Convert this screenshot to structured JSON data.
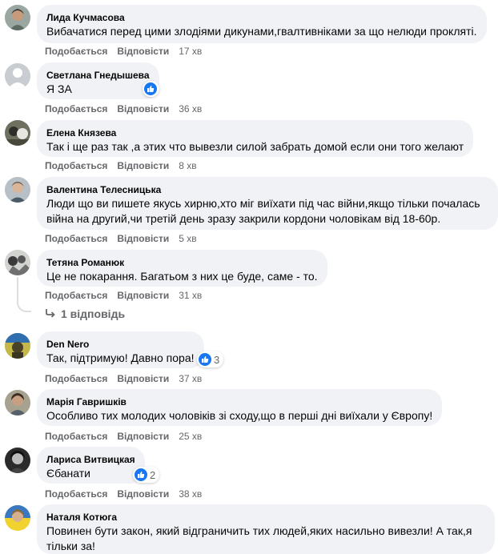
{
  "actions": {
    "like": "Подобається",
    "reply": "Відповісти"
  },
  "comments": [
    {
      "author": "Лида Кучмасова",
      "text": "Вибачатися перед цими злодіями дикунами,гвалтивніками за що нелюди прокляті.",
      "time": "17 хв"
    },
    {
      "author": "Светлана Гнедышева",
      "text": "Я ЗА",
      "time": "36 хв"
    },
    {
      "author": "Елена Князева",
      "text": "Так і ще раз так ,а этих что вывезли силой забрать домой если они того желают",
      "time": "8 хв"
    },
    {
      "author": "Валентина Телесницька",
      "text": "Люди що ви пишете якусь хирню,хто міг виїхати під час війни,якщо тільки почалась війна на другий,чи третій день зразу закрили кордони чоловікам від 18-60р.",
      "time": "5 хв"
    },
    {
      "author": "Тетяна Романюк",
      "text": "Це не покарання. Багатьом з них це буде, саме - то.",
      "time": "31 хв",
      "replies": "1 відповідь"
    },
    {
      "author": "Den Nero",
      "text": "Так, підтримую! Давно пора!",
      "time": "37 хв",
      "reactions": "3"
    },
    {
      "author": "Марія Гавришків",
      "text": "Особливо тих молодих чоловіків зі сходу,що в перші дні виїхали у Європу!",
      "time": "25 хв"
    },
    {
      "author": "Лариса Витвицкая",
      "text": "Єбанати",
      "time": "38 хв",
      "reactions": "2"
    },
    {
      "author": "Наталя Котюга",
      "text": "Повинен бути закон, який відграничить тих людей,яких насильно вивезли! А так,я тільки за!",
      "time": ""
    }
  ],
  "colors": {
    "bubble": "#f0f2f5",
    "meta": "#65676b",
    "like": "#1877f2"
  }
}
